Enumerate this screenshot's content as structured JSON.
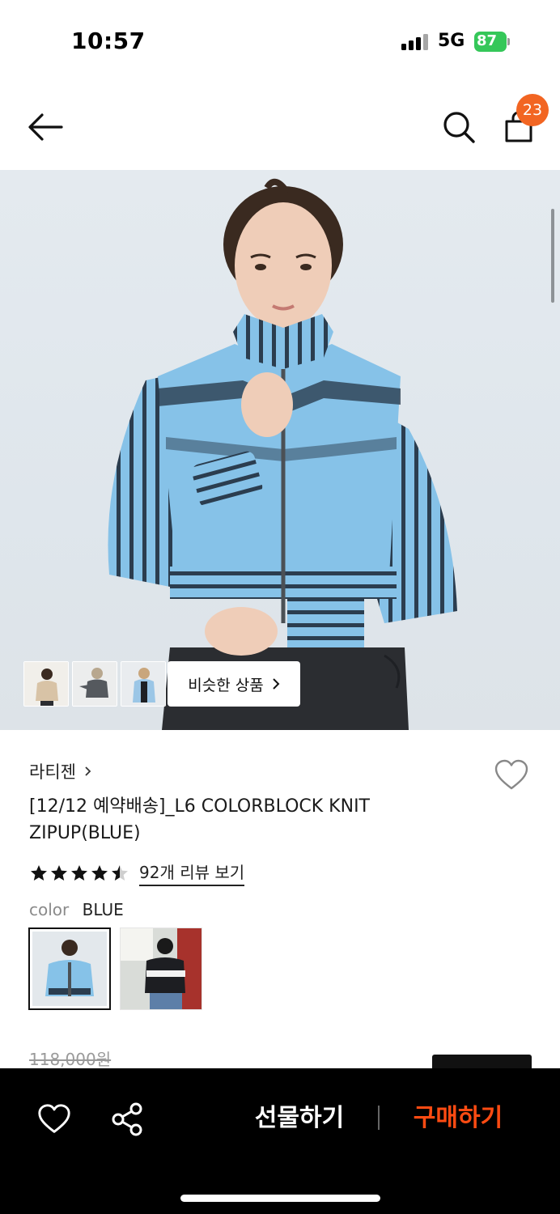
{
  "status_bar": {
    "time": "10:57",
    "network": "5G",
    "battery": "87"
  },
  "header": {
    "back_icon": "arrow-left-icon",
    "search_icon": "search-icon",
    "bag_icon": "shopping-bag-icon",
    "cart_count": "23"
  },
  "gallery": {
    "thumbnails": [
      "beige-knit-thumbnail",
      "gray-knit-thumbnail",
      "blue-knit-thumbnail"
    ],
    "similar_label": "비슷한 상품",
    "similar_chevron": "›"
  },
  "product": {
    "brand": "라티젠",
    "brand_chevron": "›",
    "title": "[12/12 예약배송]_L6 COLORBLOCK KNIT ZIPUP(BLUE)",
    "rating": 4.5,
    "rating_max": 5,
    "review_link": "92개 리뷰 보기",
    "color_label": "color",
    "color_value": "BLUE",
    "original_price": "118,000원"
  },
  "bottom_bar": {
    "like_icon": "heart-outline-icon",
    "share_icon": "share-icon",
    "gift_label": "선물하기",
    "buy_label": "구매하기"
  },
  "colors": {
    "badge": "#f26522",
    "buy_accent": "#ff4b12",
    "battery": "#35c759",
    "bottom_bar_bg": "#000000",
    "sweater_blue": "#86c2e8"
  }
}
